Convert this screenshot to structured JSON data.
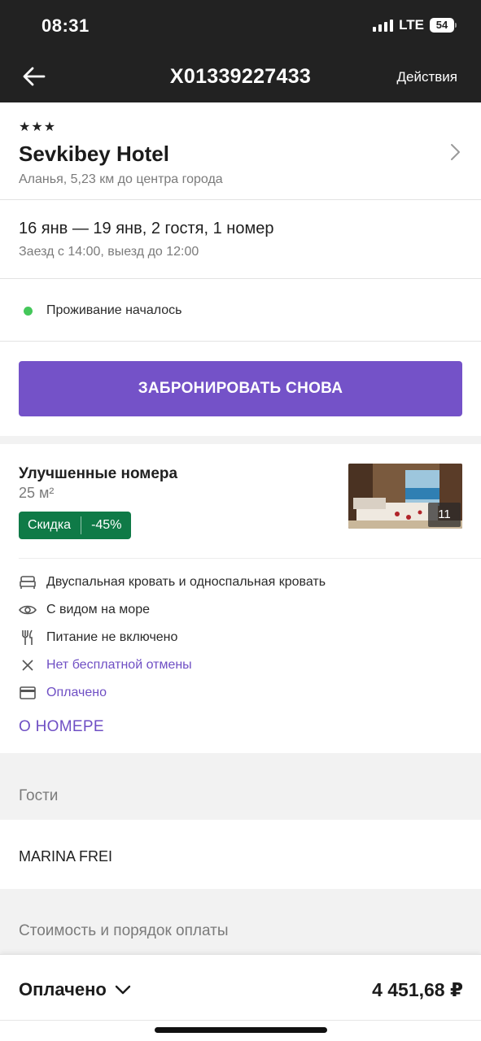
{
  "status_bar": {
    "time": "08:31",
    "network": "LTE",
    "battery": "54"
  },
  "nav": {
    "title": "X01339227433",
    "actions_label": "Действия"
  },
  "hotel": {
    "stars": "★★★",
    "name": "Sevkibey Hotel",
    "location": "Аланья, 5,23 км до центра города"
  },
  "stay": {
    "dates": "16 янв — 19 янв, 2 гостя, 1 номер",
    "checkin_checkout": "Заезд с 14:00, выезд до 12:00"
  },
  "status": {
    "text": "Проживание началось",
    "color": "#44c75a"
  },
  "rebook_button": {
    "label": "ЗАБРОНИРОВАТЬ СНОВА",
    "color": "#7452c8"
  },
  "room": {
    "title": "Улучшенные номера",
    "size": "25 м²",
    "discount_label": "Скидка",
    "discount_value": "-45%",
    "photo_count": "11",
    "features": [
      {
        "icon": "bed-icon",
        "text": "Двуспальная кровать и односпальная кровать",
        "link": false
      },
      {
        "icon": "eye-icon",
        "text": "С видом на море",
        "link": false
      },
      {
        "icon": "fork-knife-icon",
        "text": "Питание не включено",
        "link": false
      },
      {
        "icon": "close-icon",
        "text": "Нет бесплатной отмены",
        "link": true
      },
      {
        "icon": "credit-card-icon",
        "text": "Оплачено",
        "link": true
      }
    ],
    "about_label": "О НОМЕРЕ"
  },
  "guests": {
    "title": "Гости",
    "names": [
      "MARINA FREI"
    ]
  },
  "payment": {
    "title": "Стоимость и порядок оплаты",
    "paid_label": "Оплачено",
    "amount": "4 451,68 ₽"
  }
}
